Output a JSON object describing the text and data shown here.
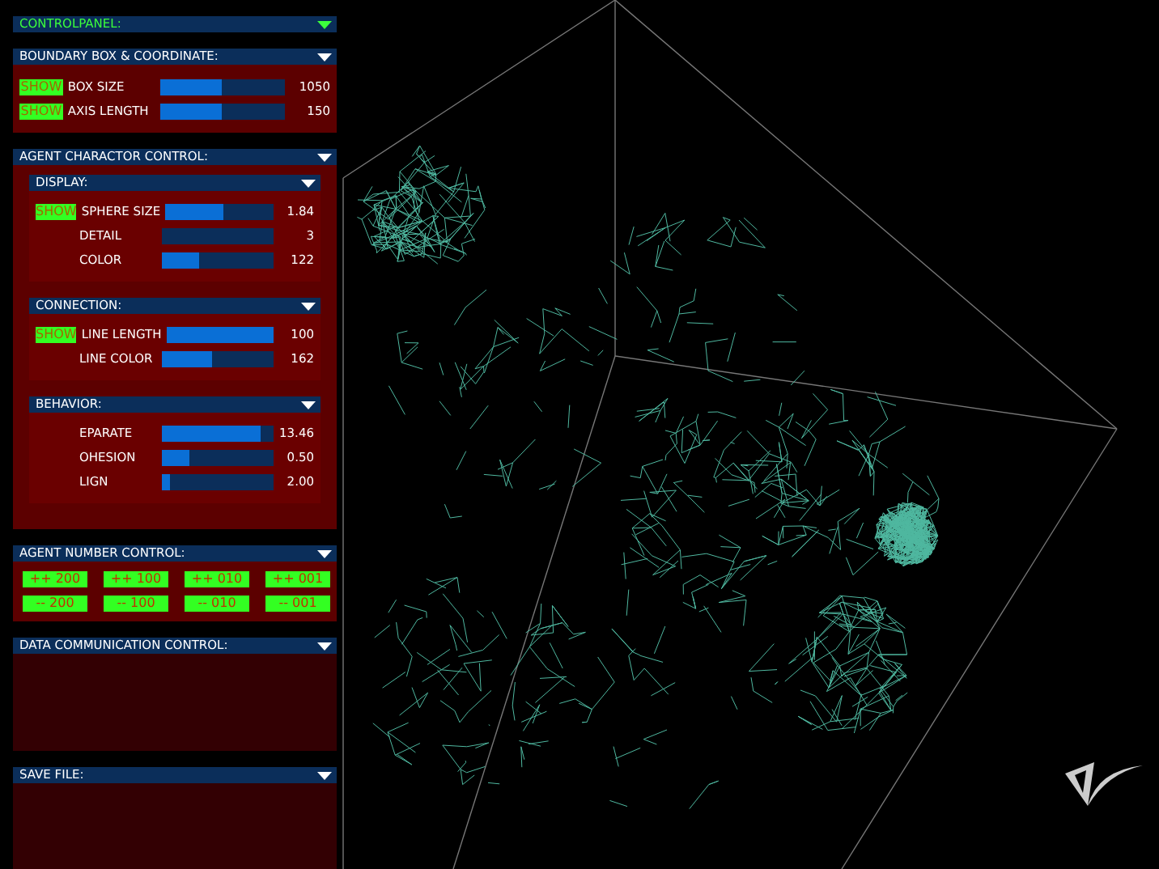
{
  "title": {
    "text": "CONTROLPANEL:",
    "expanded": true
  },
  "sections": [
    {
      "title": "BOUNDARY BOX & COORDINATE:",
      "expanded": true,
      "kind": "rows",
      "rows": [
        {
          "button": "SHOW",
          "label": "BOX SIZE",
          "level": 0.5,
          "reading": "1050"
        },
        {
          "button": "SHOW",
          "label": "AXIS LENGTH",
          "level": 0.5,
          "reading": "150"
        }
      ]
    },
    {
      "title": "AGENT CHARACTOR CONTROL:",
      "expanded": true,
      "kind": "groups",
      "groups": [
        {
          "title": "DISPLAY:",
          "expanded": true,
          "rows": [
            {
              "button": "SHOW",
              "label": "SPHERE SIZE",
              "level": 0.53,
              "reading": "1.84"
            },
            {
              "label": "DETAIL",
              "level": 0,
              "reading": "3"
            },
            {
              "label": "COLOR",
              "level": 0.34,
              "reading": "122"
            }
          ]
        },
        {
          "title": "CONNECTION:",
          "expanded": true,
          "rows": [
            {
              "button": "SHOW",
              "label": "LINE LENGTH",
              "level": 1,
              "reading": "100"
            },
            {
              "label": "LINE COLOR",
              "level": 0.45,
              "reading": "162"
            }
          ]
        },
        {
          "title": "BEHAVIOR:",
          "expanded": true,
          "rows": [
            {
              "label": "EPARATE",
              "level": 0.89,
              "reading": "13.46"
            },
            {
              "label": "OHESION",
              "level": 0.25,
              "reading": "0.50"
            },
            {
              "label": "LIGN",
              "level": 0.07,
              "reading": "2.00"
            }
          ]
        }
      ]
    },
    {
      "title": "AGENT NUMBER CONTROL:",
      "expanded": true,
      "kind": "buttons",
      "buttons": [
        "++ 200",
        "++ 100",
        "++ 010",
        "++ 001",
        "-- 200",
        "-- 100",
        "-- 010",
        "-- 001"
      ]
    },
    {
      "title": "DATA COMMUNICATION CONTROL:",
      "expanded": true,
      "kind": "empty"
    },
    {
      "title": "SAVE FILE:",
      "expanded": true,
      "kind": "empty"
    }
  ]
}
